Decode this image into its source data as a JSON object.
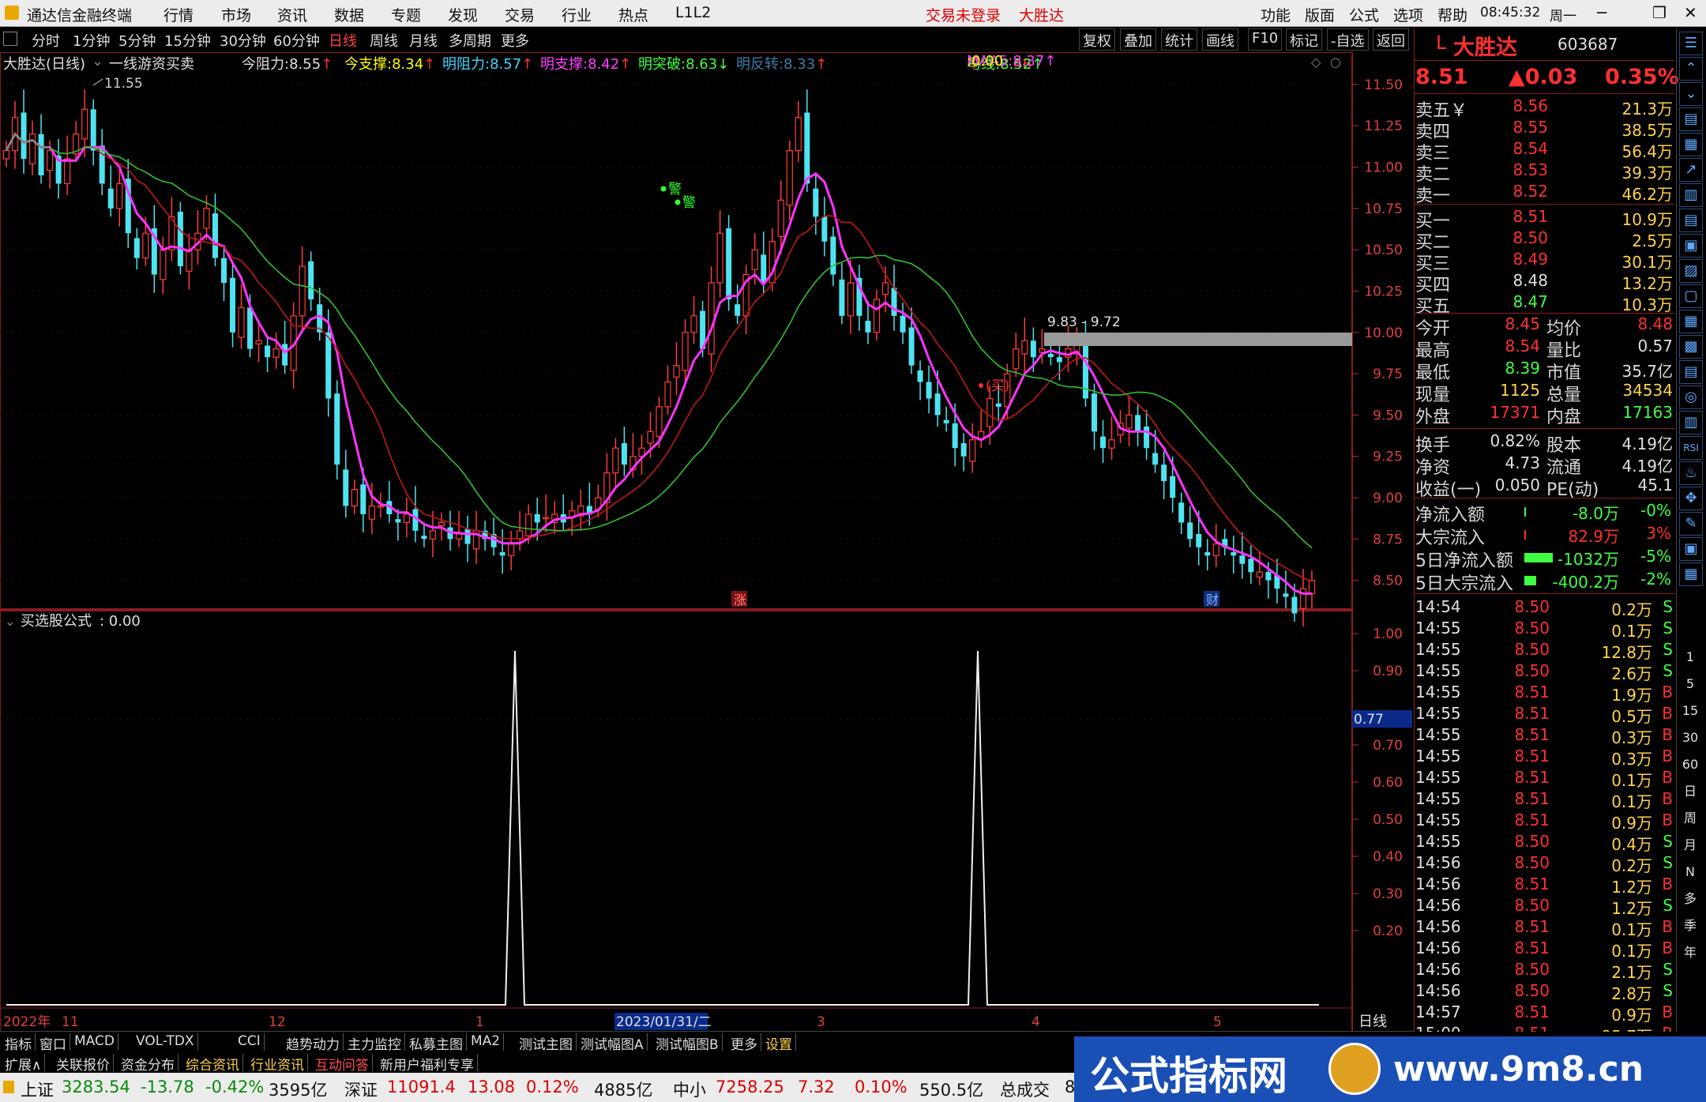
{
  "menubar": {
    "app_title": "通达信金融终端",
    "items": [
      "行情",
      "市场",
      "资讯",
      "数据",
      "专题",
      "发现",
      "交易",
      "行业",
      "热点",
      "L1L2"
    ],
    "trade_status": "交易未登录",
    "stock_name": "大胜达",
    "right_items": [
      "功能",
      "版面",
      "公式",
      "选项",
      "帮助"
    ],
    "time": "08:45:32",
    "weekday": "周一"
  },
  "periods": {
    "items": [
      "分时",
      "1分钟",
      "5分钟",
      "15分钟",
      "30分钟",
      "60分钟",
      "日线",
      "周线",
      "月线",
      "多周期",
      "更多"
    ],
    "active": "日线",
    "right_buttons": [
      "复权",
      "叠加",
      "统计",
      "画线",
      "F10",
      "标记",
      "-自选",
      "返回"
    ]
  },
  "main_chart": {
    "title": "大胜达(日线)",
    "formula": "一线游资买卖",
    "indicators": [
      {
        "label": "今阻力:",
        "value": "8.55",
        "color": "#e0e0e0",
        "arrow": "↑",
        "arrow_color": "#ff3030"
      },
      {
        "label": "今支撑:",
        "value": "8.34",
        "color": "#ffff00",
        "arrow": "↑",
        "arrow_color": "#ff3030"
      },
      {
        "label": "明阻力:",
        "value": "8.57",
        "color": "#3fd6ff",
        "arrow": "↑",
        "arrow_color": "#ff3030"
      },
      {
        "label": "明支撑:",
        "value": "8.42",
        "color": "#ff40ff",
        "arrow": "↑",
        "arrow_color": "#ff3030"
      },
      {
        "label": "明突破:",
        "value": "8.63",
        "color": "#40ff40",
        "arrow": "↓",
        "arrow_color": "#40ff40"
      },
      {
        "label": "明反转:",
        "value": "8.33",
        "color": "#3a7fa8",
        "arrow": "↑",
        "arrow_color": "#ff3030"
      }
    ],
    "ma_labels": [
      {
        "label": "牛线:",
        "value": "8.46",
        "arrow": "↑",
        "color": "#ff3030"
      },
      {
        "label": "马线:",
        "value": "8.52",
        "arrow": "↑",
        "color": "#40ff40"
      },
      {
        "label": "MAA5:",
        "value": "8.37",
        "arrow": "↑",
        "color": "#ff40ff"
      },
      {
        "label": ":",
        "value": "0.00",
        "arrow": "",
        "color": "#ffff00"
      }
    ],
    "y_ticks": [
      "11.50",
      "11.25",
      "11.00",
      "10.75",
      "10.50",
      "10.25",
      "10.00",
      "9.75",
      "9.50",
      "9.25",
      "9.00",
      "8.75",
      "8.50"
    ],
    "high_mark": "11.55",
    "range_label": "9.83 - 9.72",
    "buy_label": "(买)",
    "warn_label": "警",
    "up_badge": "涨",
    "fin_badge": "财"
  },
  "sub_chart": {
    "title": "买选股公式",
    "value": ": 0.00",
    "y_ticks": [
      "1.00",
      "0.90",
      "0.77",
      "0.70",
      "0.60",
      "0.50",
      "0.40",
      "0.30",
      "0.20"
    ],
    "cursor_value": "0.77"
  },
  "x_axis": {
    "labels": [
      "2022年",
      "11",
      "12",
      "1",
      "2023/01/31/二",
      "3",
      "4",
      "5"
    ],
    "period": "日线"
  },
  "quote": {
    "code_prefix": "L",
    "name": "大胜达",
    "code": "603687",
    "price": "8.51",
    "change": "▲0.03",
    "pct": "0.35%",
    "asks": [
      {
        "label": "卖五￥",
        "price": "8.56",
        "vol": "21.3万"
      },
      {
        "label": "卖四",
        "price": "8.55",
        "vol": "38.5万"
      },
      {
        "label": "卖三",
        "price": "8.54",
        "vol": "56.4万"
      },
      {
        "label": "卖二",
        "price": "8.53",
        "vol": "39.3万"
      },
      {
        "label": "卖一",
        "price": "8.52",
        "vol": "46.2万"
      }
    ],
    "bids": [
      {
        "label": "买一",
        "price": "8.51",
        "vol": "10.9万"
      },
      {
        "label": "买二",
        "price": "8.50",
        "vol": "2.5万"
      },
      {
        "label": "买三",
        "price": "8.49",
        "vol": "30.1万"
      },
      {
        "label": "买四",
        "price": "8.48",
        "vol": "13.2万"
      },
      {
        "label": "买五",
        "price": "8.47",
        "vol": "10.3万"
      }
    ],
    "stats": [
      {
        "l1": "今开",
        "v1": "8.45",
        "l2": "均价",
        "v2": "8.48"
      },
      {
        "l1": "最高",
        "v1": "8.54",
        "l2": "量比",
        "v2": "0.57"
      },
      {
        "l1": "最低",
        "v1": "8.39",
        "l2": "市值",
        "v2": "35.7亿"
      },
      {
        "l1": "现量",
        "v1": "1125",
        "l2": "总量",
        "v2": "34534"
      },
      {
        "l1": "外盘",
        "v1": "17371",
        "l2": "内盘",
        "v2": "17163"
      }
    ],
    "stats2": [
      {
        "l1": "换手",
        "v1": "0.82%",
        "l2": "股本",
        "v2": "4.19亿"
      },
      {
        "l1": "净资",
        "v1": "4.73",
        "l2": "流通",
        "v2": "4.19亿"
      },
      {
        "l1": "收益(一)",
        "v1": "0.050",
        "l2": "PE(动)",
        "v2": "45.1"
      }
    ],
    "flows": [
      {
        "label": "净流入额",
        "value": "-8.0万",
        "pct": "-0%",
        "vcolor": "#40ff40",
        "pcolor": "#40ff40",
        "bar": "#40ff40",
        "bar_frac": 0.02
      },
      {
        "label": "大宗流入",
        "value": "82.9万",
        "pct": "3%",
        "vcolor": "#ff3030",
        "pcolor": "#ff3030",
        "bar": "#ff3030",
        "bar_frac": 0.02
      },
      {
        "label": "5日净流入额",
        "value": "-1032万",
        "pct": "-5%",
        "vcolor": "#40ff40",
        "pcolor": "#40ff40",
        "bar": "#40ff40",
        "bar_frac": 0.6
      },
      {
        "label": "5日大宗流入",
        "value": "-400.2万",
        "pct": "-2%",
        "vcolor": "#40ff40",
        "pcolor": "#40ff40",
        "bar": "#40ff40",
        "bar_frac": 0.25
      }
    ],
    "ticks": [
      {
        "t": "14:54",
        "p": "8.50",
        "v": "0.2万",
        "s": "S"
      },
      {
        "t": "14:55",
        "p": "8.50",
        "v": "0.1万",
        "s": "S"
      },
      {
        "t": "14:55",
        "p": "8.50",
        "v": "12.8万",
        "s": "S"
      },
      {
        "t": "14:55",
        "p": "8.50",
        "v": "2.6万",
        "s": "S"
      },
      {
        "t": "14:55",
        "p": "8.51",
        "v": "1.9万",
        "s": "B"
      },
      {
        "t": "14:55",
        "p": "8.51",
        "v": "0.5万",
        "s": "B"
      },
      {
        "t": "14:55",
        "p": "8.51",
        "v": "0.3万",
        "s": "B"
      },
      {
        "t": "14:55",
        "p": "8.51",
        "v": "0.3万",
        "s": "B"
      },
      {
        "t": "14:55",
        "p": "8.51",
        "v": "0.1万",
        "s": "B"
      },
      {
        "t": "14:55",
        "p": "8.51",
        "v": "0.1万",
        "s": "B"
      },
      {
        "t": "14:55",
        "p": "8.51",
        "v": "0.9万",
        "s": "B"
      },
      {
        "t": "14:55",
        "p": "8.50",
        "v": "0.4万",
        "s": "S"
      },
      {
        "t": "14:56",
        "p": "8.50",
        "v": "0.2万",
        "s": "S"
      },
      {
        "t": "14:56",
        "p": "8.51",
        "v": "1.2万",
        "s": "B"
      },
      {
        "t": "14:56",
        "p": "8.50",
        "v": "1.2万",
        "s": "S"
      },
      {
        "t": "14:56",
        "p": "8.51",
        "v": "0.1万",
        "s": "B"
      },
      {
        "t": "14:56",
        "p": "8.51",
        "v": "0.1万",
        "s": "B"
      },
      {
        "t": "14:56",
        "p": "8.50",
        "v": "2.1万",
        "s": "S"
      },
      {
        "t": "14:56",
        "p": "8.50",
        "v": "2.8万",
        "s": "S"
      },
      {
        "t": "14:57",
        "p": "8.51",
        "v": "0.9万",
        "s": "B"
      },
      {
        "t": "15:00",
        "p": "8.51",
        "v": "95.7万",
        "s": "B"
      }
    ]
  },
  "sidebar_labels": [
    "1",
    "5",
    "15",
    "30",
    "60",
    "日",
    "周",
    "月",
    "N",
    "多",
    "季",
    "年"
  ],
  "bottom_tabs": [
    "指标",
    "窗口",
    "MACD",
    "VOL-TDX",
    "CCI",
    "趋势动力",
    "主力监控",
    "私募主图",
    "MA2",
    "测试主图",
    "测试幅图A",
    "测试幅图B",
    "更多",
    "设置"
  ],
  "bottom_tabs2": [
    "扩展∧",
    "关联报价",
    "资金分布",
    "综合资讯",
    "行业资讯",
    "互动问答",
    "新用户福利专享"
  ],
  "status": {
    "sh_label": "上证",
    "sh_val": "3283.54",
    "sh_chg": "-13.78",
    "sh_pct": "-0.42%",
    "sh_amt": "3595亿",
    "sz_label": "深证",
    "sz_val": "11091.4",
    "sz_chg": "13.08",
    "sz_pct": "0.12%",
    "sz_amt": "4885亿",
    "zx_label": "中小",
    "zx_val": "7258.25",
    "zx_chg": "7.32",
    "zx_pct": "0.10%",
    "zx_amt": "550.5亿",
    "total_label": "总成交",
    "total_val": "8"
  },
  "watermark": {
    "text": "公式指标网",
    "url": "www.9m8.cn"
  }
}
